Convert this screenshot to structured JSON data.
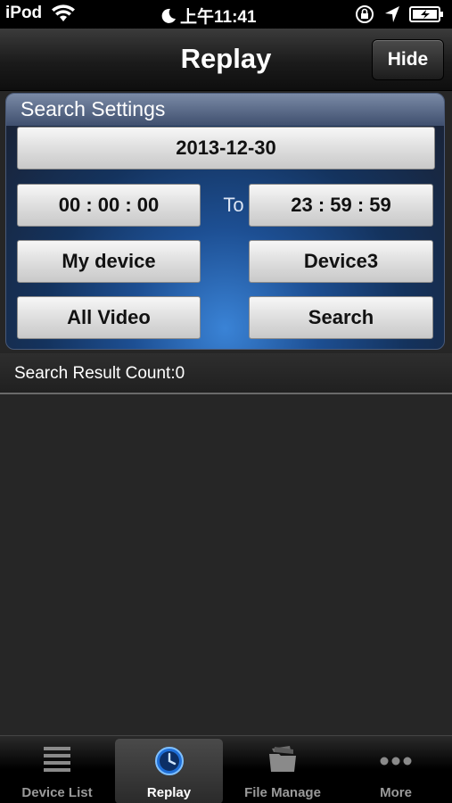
{
  "status_bar": {
    "carrier": "iPod",
    "time": "上午11:41",
    "icons": [
      "wifi-icon",
      "moon-icon",
      "rotation-lock-icon",
      "location-icon",
      "battery-icon"
    ]
  },
  "nav": {
    "title": "Replay",
    "hide_label": "Hide"
  },
  "search_settings": {
    "header": "Search Settings",
    "date": "2013-12-30",
    "start_time": "00 : 00 : 00",
    "to_label": "To",
    "end_time": "23 : 59 : 59",
    "device_group": "My device",
    "device": "Device3",
    "video_type": "All Video",
    "search_label": "Search"
  },
  "result": {
    "count_text": "Search Result Count:0",
    "items": []
  },
  "tabs": [
    {
      "label": "Device List",
      "icon": "list-icon",
      "active": false
    },
    {
      "label": "Replay",
      "icon": "clock-icon",
      "active": true
    },
    {
      "label": "File Manage",
      "icon": "folder-icon",
      "active": false
    },
    {
      "label": "More",
      "icon": "more-dots-icon",
      "active": false
    }
  ],
  "colors": {
    "accent_blue": "#2a6fd1",
    "background": "#262626"
  }
}
